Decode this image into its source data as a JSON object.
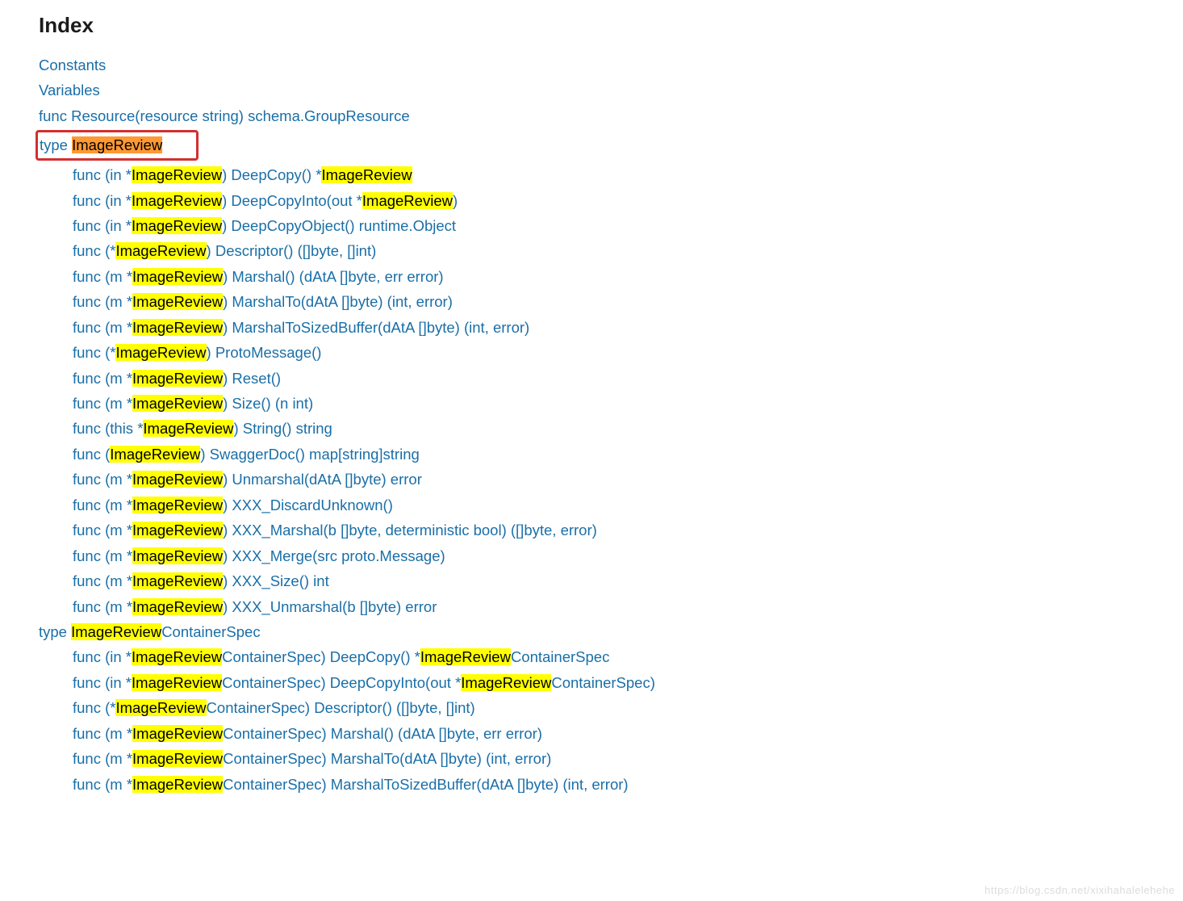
{
  "title": "Index",
  "watermark": "https://blog.csdn.net/xixihahalelehehe",
  "hl": "ImageReview",
  "top_links": [
    "Constants",
    "Variables",
    "func Resource(resource string) schema.GroupResource"
  ],
  "boxed": {
    "prefix": "type ",
    "highlight": "ImageReview",
    "style": "orange"
  },
  "methods1": [
    {
      "pre": "func (in *",
      "post": ") DeepCopy() *",
      "tail_hl": "ImageReview",
      "tail": ""
    },
    {
      "pre": "func (in *",
      "post": ") DeepCopyInto(out *",
      "tail_hl": "ImageReview",
      "tail": ")"
    },
    {
      "pre": "func (in *",
      "post": ") DeepCopyObject() runtime.Object"
    },
    {
      "pre": "func (*",
      "post": ") Descriptor() ([]byte, []int)"
    },
    {
      "pre": "func (m *",
      "post": ") Marshal() (dAtA []byte, err error)"
    },
    {
      "pre": "func (m *",
      "post": ") MarshalTo(dAtA []byte) (int, error)"
    },
    {
      "pre": "func (m *",
      "post": ") MarshalToSizedBuffer(dAtA []byte) (int, error)"
    },
    {
      "pre": "func (*",
      "post": ") ProtoMessage()"
    },
    {
      "pre": "func (m *",
      "post": ") Reset()"
    },
    {
      "pre": "func (m *",
      "post": ") Size() (n int)"
    },
    {
      "pre": "func (this *",
      "post": ") String() string"
    },
    {
      "pre": "func (",
      "post": ") SwaggerDoc() map[string]string"
    },
    {
      "pre": "func (m *",
      "post": ") Unmarshal(dAtA []byte) error"
    },
    {
      "pre": "func (m *",
      "post": ") XXX_DiscardUnknown()"
    },
    {
      "pre": "func (m *",
      "post": ") XXX_Marshal(b []byte, deterministic bool) ([]byte, error)"
    },
    {
      "pre": "func (m *",
      "post": ") XXX_Merge(src proto.Message)"
    },
    {
      "pre": "func (m *",
      "post": ") XXX_Size() int"
    },
    {
      "pre": "func (m *",
      "post": ") XXX_Unmarshal(b []byte) error"
    }
  ],
  "type2": {
    "prefix": "type ",
    "hl": "ImageReview",
    "suffix": "ContainerSpec"
  },
  "methods2": [
    {
      "pre": "func (in *",
      "mid": "ContainerSpec) DeepCopy() *",
      "tail_hl": "ImageReview",
      "tail": "ContainerSpec"
    },
    {
      "pre": "func (in *",
      "mid": "ContainerSpec) DeepCopyInto(out *",
      "tail_hl": "ImageReview",
      "tail": "ContainerSpec)"
    },
    {
      "pre": "func (*",
      "mid": "ContainerSpec) Descriptor() ([]byte, []int)"
    },
    {
      "pre": "func (m *",
      "mid": "ContainerSpec) Marshal() (dAtA []byte, err error)"
    },
    {
      "pre": "func (m *",
      "mid": "ContainerSpec) MarshalTo(dAtA []byte) (int, error)"
    },
    {
      "pre": "func (m *",
      "mid": "ContainerSpec) MarshalToSizedBuffer(dAtA []byte) (int, error)"
    }
  ]
}
